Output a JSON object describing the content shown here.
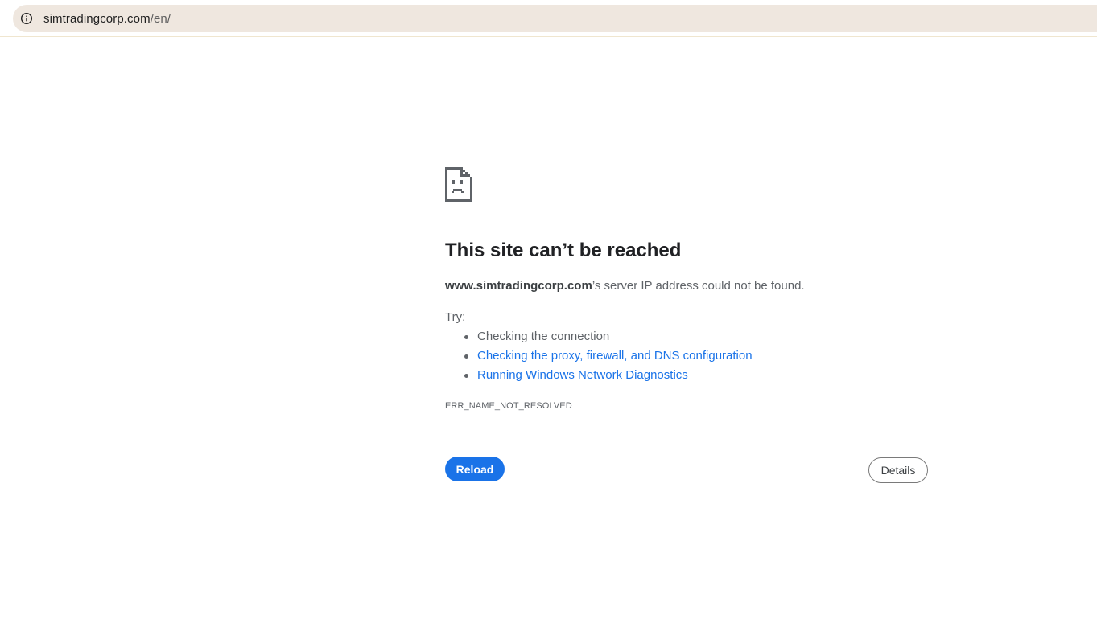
{
  "address_bar": {
    "host": "simtradingcorp.com",
    "path": "/en/",
    "info_icon": "info-icon"
  },
  "error_page": {
    "icon": "sad-page-icon",
    "title": "This site can’t be reached",
    "host_bold": "www.simtradingcorp.com",
    "message_suffix": "’s server IP address could not be found.",
    "try_label": "Try:",
    "suggestions": [
      {
        "label": "Checking the connection",
        "is_link": false
      },
      {
        "label": "Checking the proxy, firewall, and DNS configuration",
        "is_link": true
      },
      {
        "label": "Running Windows Network Diagnostics",
        "is_link": true
      }
    ],
    "error_code": "ERR_NAME_NOT_RESOLVED",
    "reload_label": "Reload",
    "details_label": "Details"
  },
  "colors": {
    "link": "#1a73e8",
    "primary_button": "#1a73e8",
    "omnibox_bg": "#efe7df",
    "text_secondary": "#5f6368"
  }
}
